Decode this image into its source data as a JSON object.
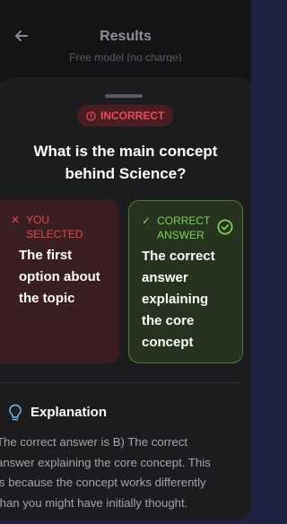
{
  "header": {
    "title": "Results",
    "ghost_text": "Free model (no charge)"
  },
  "result_badge": "INCORRECT",
  "question": "What is the main concept behind Science?",
  "selected_card": {
    "label_line1": "YOU",
    "label_line2": "SELECTED",
    "answer_lines": [
      "The first",
      "option about",
      "the topic"
    ]
  },
  "correct_card": {
    "label_line1": "CORRECT",
    "label_line2": "ANSWER",
    "answer_lines": [
      "The correct",
      "answer",
      "explaining",
      "the core",
      "concept"
    ]
  },
  "explanation": {
    "title": "Explanation",
    "lines": [
      "The correct answer is B) The correct",
      "answer explaining the core concept. This",
      "is because the concept works differently",
      "than you might have initially thought."
    ]
  },
  "colors": {
    "incorrect": "#ef4b54",
    "correct": "#7fd15a",
    "background": "#1c1c1e"
  }
}
